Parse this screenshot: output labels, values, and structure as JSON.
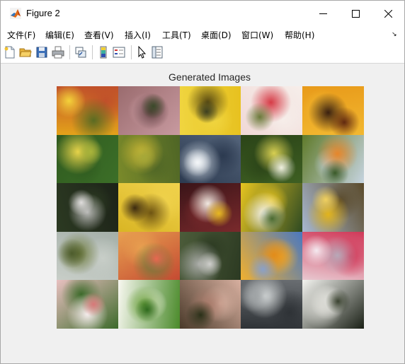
{
  "window": {
    "title": "Figure 2"
  },
  "menu": {
    "items": [
      {
        "label": "文件(F)",
        "name": "menu-file"
      },
      {
        "label": "编辑(E)",
        "name": "menu-edit"
      },
      {
        "label": "查看(V)",
        "name": "menu-view"
      },
      {
        "label": "插入(I)",
        "name": "menu-insert"
      },
      {
        "label": "工具(T)",
        "name": "menu-tools"
      },
      {
        "label": "桌面(D)",
        "name": "menu-desktop"
      },
      {
        "label": "窗口(W)",
        "name": "menu-window"
      },
      {
        "label": "帮助(H)",
        "name": "menu-help"
      }
    ]
  },
  "toolbar": {
    "buttons": [
      {
        "name": "new-figure-icon"
      },
      {
        "name": "open-file-icon"
      },
      {
        "name": "save-icon"
      },
      {
        "name": "print-icon"
      },
      {
        "name": "link-plot-icon"
      },
      {
        "name": "colorbar-icon"
      },
      {
        "name": "legend-icon"
      },
      {
        "name": "edit-plot-arrow-icon"
      },
      {
        "name": "property-inspector-icon"
      }
    ]
  },
  "axes": {
    "title": "Generated Images"
  },
  "images": [
    {
      "desc": "yellow-orange flowers",
      "colors": [
        "#e3a21a",
        "#5a6b22",
        "#c0502a",
        "#f4d23a"
      ]
    },
    {
      "desc": "pink-brown petals",
      "colors": [
        "#9a6b6e",
        "#5e3d40",
        "#c89aa0",
        "#3b4a2a"
      ]
    },
    {
      "desc": "yellow flowers cluster",
      "colors": [
        "#e7c11f",
        "#5a4b12",
        "#f0d540",
        "#3d4020"
      ]
    },
    {
      "desc": "white-red flowers",
      "colors": [
        "#f0d8d6",
        "#d63b46",
        "#f6eeea",
        "#6b7a3a"
      ]
    },
    {
      "desc": "orange flower dark bg",
      "colors": [
        "#e89a1a",
        "#3a2010",
        "#f2b830",
        "#602810"
      ]
    },
    {
      "desc": "yellow flower green",
      "colors": [
        "#3c6f28",
        "#e8d44a",
        "#2f5a1f",
        "#a9b43a"
      ]
    },
    {
      "desc": "yellow-green field",
      "colors": [
        "#7a8a2a",
        "#c9b635",
        "#4e6526",
        "#a5a838"
      ]
    },
    {
      "desc": "grey-blue water",
      "colors": [
        "#54647a",
        "#c8d2dc",
        "#2c3a50",
        "#f4f6f8"
      ]
    },
    {
      "desc": "green field white dots",
      "colors": [
        "#3e5f22",
        "#d8cf52",
        "#2b4418",
        "#f0f0e0"
      ]
    },
    {
      "desc": "orange field",
      "colors": [
        "#5f7a2a",
        "#e6862a",
        "#c6d4e0",
        "#3a5a28"
      ]
    },
    {
      "desc": "white puff dark",
      "colors": [
        "#1c2218",
        "#b8b8b6",
        "#2c3a22",
        "#e0dedd"
      ]
    },
    {
      "desc": "yellow flower closeup",
      "colors": [
        "#d9b524",
        "#6e5412",
        "#f0d24c",
        "#3c2a10"
      ]
    },
    {
      "desc": "white flowers dark red",
      "colors": [
        "#3a1418",
        "#f0e8e0",
        "#7a2a2c",
        "#e8b820"
      ]
    },
    {
      "desc": "white daisy",
      "colors": [
        "#2e4a22",
        "#f8f6f2",
        "#e6c420",
        "#4a6a30"
      ]
    },
    {
      "desc": "yellow flower blue sky",
      "colors": [
        "#a8b8d0",
        "#e2b41c",
        "#5a4a2a",
        "#f0d060"
      ]
    },
    {
      "desc": "misty field",
      "colors": [
        "#a4afa8",
        "#6d7a3a",
        "#c8cec8",
        "#4d5c2c"
      ]
    },
    {
      "desc": "red flowers",
      "colors": [
        "#c44a32",
        "#6a7a3a",
        "#e8a050",
        "#e86850"
      ]
    },
    {
      "desc": "grey puff",
      "colors": [
        "#4c5c3a",
        "#a8aaa6",
        "#2c3a22",
        "#cfcfcc"
      ]
    },
    {
      "desc": "orange field blue sky",
      "colors": [
        "#4a78c0",
        "#e28c1a",
        "#f0b030",
        "#8aa0c8"
      ]
    },
    {
      "desc": "pink blossoms",
      "colors": [
        "#e8c8d0",
        "#b8a8b8",
        "#d03858",
        "#f4eaf0"
      ]
    },
    {
      "desc": "pink white blur",
      "colors": [
        "#e8c0c0",
        "#f6eeee",
        "#3c6a2a",
        "#d87878"
      ]
    },
    {
      "desc": "small white flower green",
      "colors": [
        "#4a8a2a",
        "#6aa03a",
        "#f8f8f0",
        "#2f6a1e"
      ]
    },
    {
      "desc": "dark pink flowers",
      "colors": [
        "#4a3a2a",
        "#a87a6a",
        "#d8b0a0",
        "#2a3018"
      ]
    },
    {
      "desc": "grey white",
      "colors": [
        "#6a6e72",
        "#d8dcdc",
        "#2e3236",
        "#a0a4a6"
      ]
    },
    {
      "desc": "dandelion",
      "colors": [
        "#1a2016",
        "#d8d8d2",
        "#f4f4f0",
        "#3a4230"
      ]
    }
  ]
}
